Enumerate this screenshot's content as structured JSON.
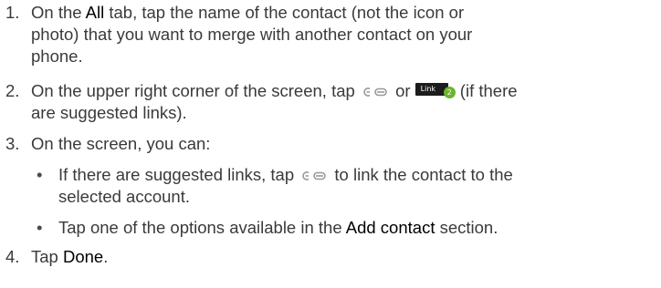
{
  "steps": [
    {
      "number": "1.",
      "line1_a": "On the ",
      "line1_b": "All",
      "line1_c": " tab, tap the name of the contact (not the icon or",
      "line2": "photo) that you want to merge with another contact on your",
      "line3": "phone."
    },
    {
      "number": "2.",
      "line1_a": "On the upper right corner of the screen, tap ",
      "line1_b": " or ",
      "line1_c": " (if there",
      "line2": "are suggested links)."
    },
    {
      "number": "3.",
      "line1": "On the screen, you can:",
      "bullets": [
        {
          "line1_a": "If there are suggested links, tap ",
          "line1_b": " to link the contact to the",
          "line2": "selected account."
        },
        {
          "line1_a": "Tap one of the options available in the ",
          "line1_b": "Add contact",
          "line1_c": " section."
        }
      ]
    },
    {
      "number": "4.",
      "line1_a": "Tap ",
      "line1_b": "Done",
      "line1_c": "."
    }
  ],
  "icons": {
    "link_icon": "link-icon",
    "link_button_label": "Link",
    "link_button_badge": "2",
    "badge_color": "#6cb42c"
  }
}
